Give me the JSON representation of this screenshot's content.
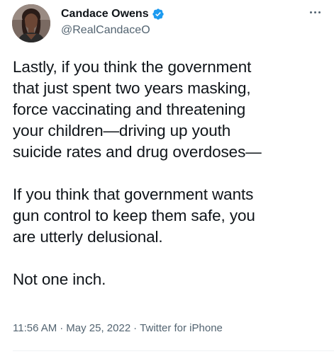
{
  "author": {
    "display_name": "Candace Owens",
    "handle": "@RealCandaceO",
    "verified": true,
    "verified_color": "#1d9bf0"
  },
  "icons": {
    "verified": "verified-badge-icon",
    "more": "more-options-icon",
    "avatar": "profile-avatar"
  },
  "tweet": {
    "paragraphs": [
      {
        "lines": [
          "Lastly, if you think the government",
          "that just spent two years masking,",
          "force vaccinating and threatening",
          "your children—driving up youth",
          "suicide rates and drug overdoses—"
        ]
      },
      {
        "lines": [
          "If you think that government wants",
          "gun control to keep them safe, you",
          "are utterly delusional."
        ]
      },
      {
        "lines": [
          "Not one inch."
        ]
      }
    ]
  },
  "meta": {
    "time": "11:56 AM",
    "separator": "·",
    "date": "May 25, 2022",
    "source": "Twitter for iPhone"
  }
}
